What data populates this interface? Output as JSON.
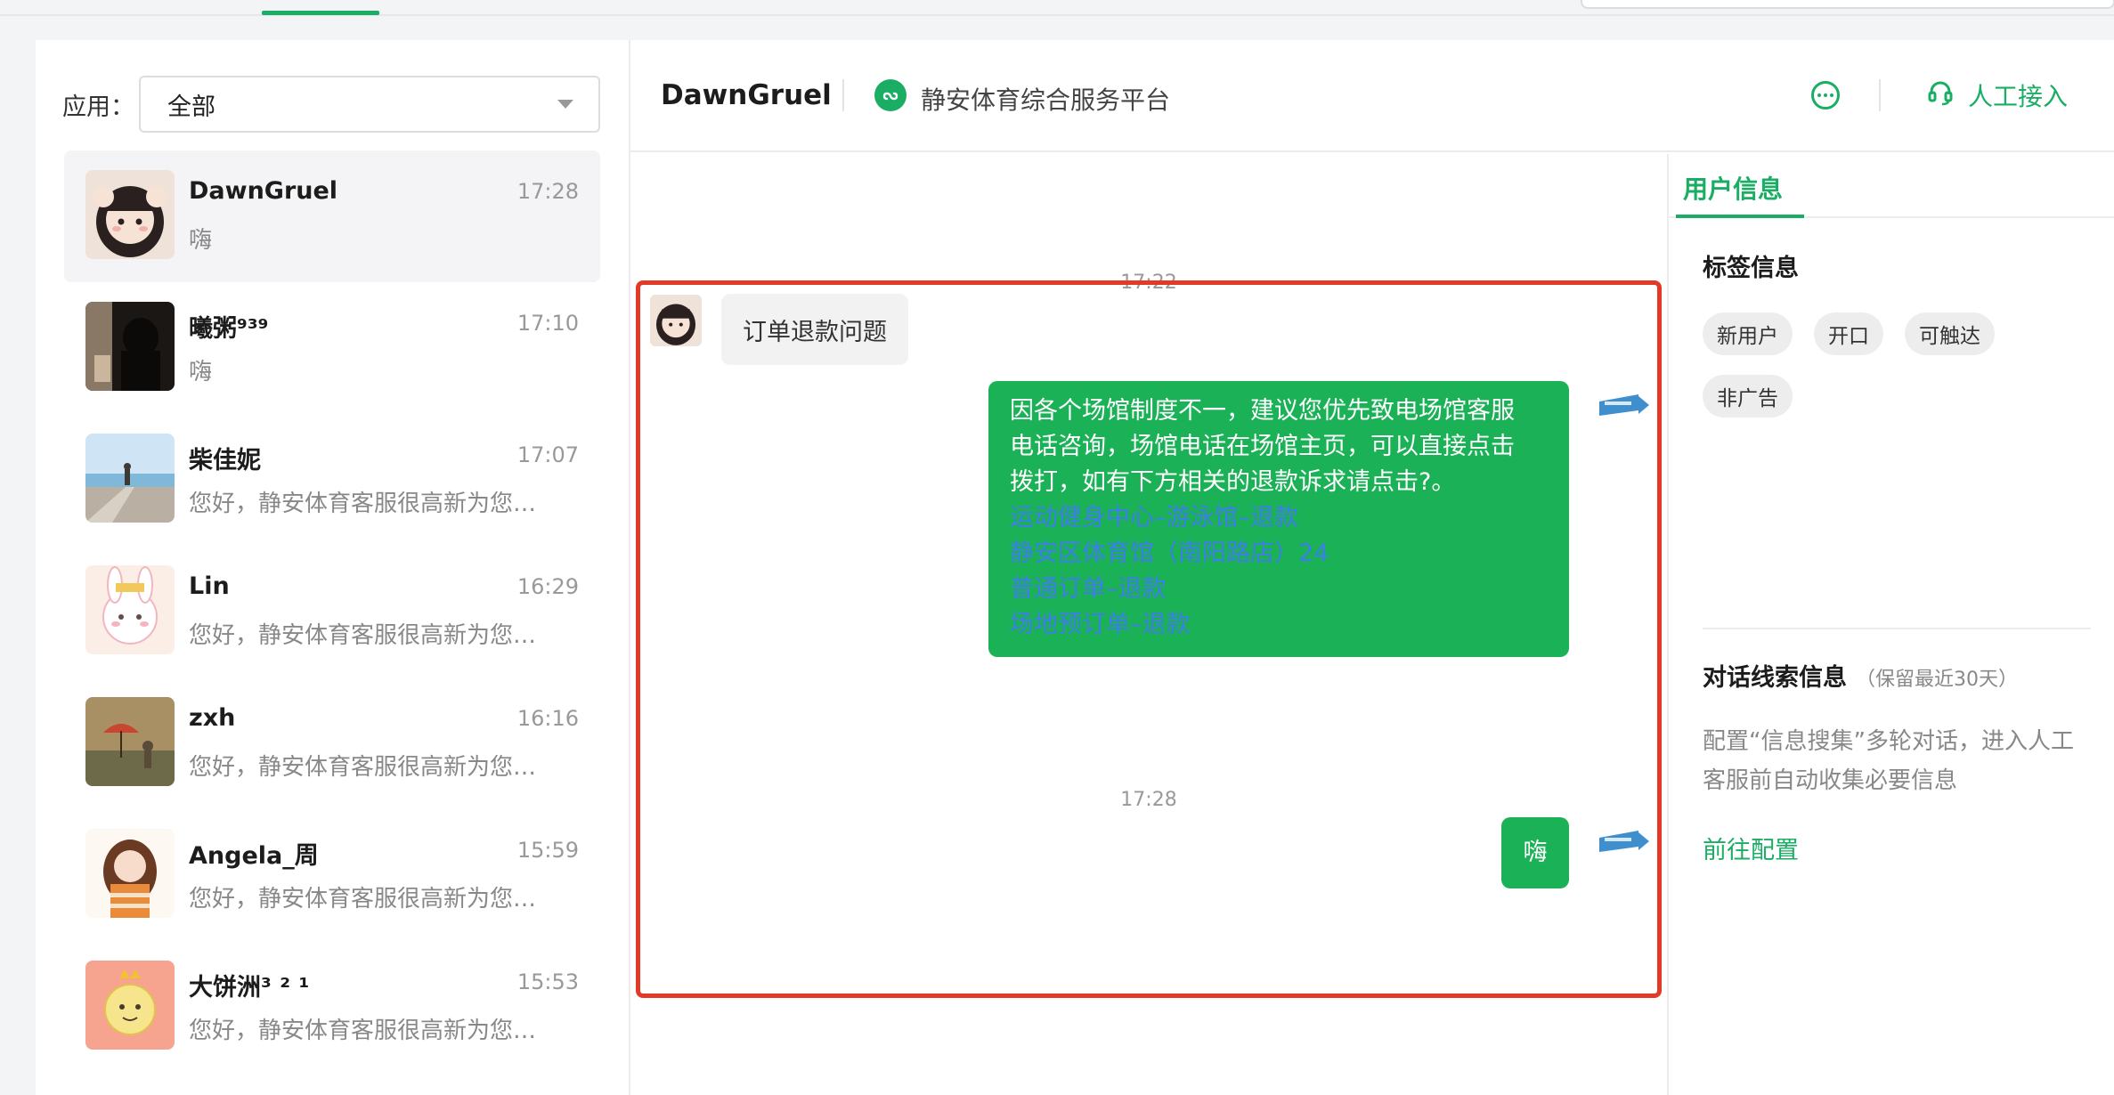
{
  "app_filter": {
    "label": "应用：",
    "value": "全部"
  },
  "conversations": [
    {
      "name": "DawnGruel",
      "time": "17:28",
      "snippet": "嗨",
      "avatar": "girl-cartoon-avatar"
    },
    {
      "name": "曦粥⁹³⁹",
      "time": "17:10",
      "snippet": "嗨",
      "avatar": "dark-photo-avatar"
    },
    {
      "name": "柴佳妮",
      "time": "17:07",
      "snippet": "您好，静安体育客服很高新为您…",
      "avatar": "seaside-photo-avatar"
    },
    {
      "name": "Lin",
      "time": "16:29",
      "snippet": "您好，静安体育客服很高新为您…",
      "avatar": "pink-bunny-avatar"
    },
    {
      "name": "zxh",
      "time": "16:16",
      "snippet": "您好，静安体育客服很高新为您…",
      "avatar": "painting-avatar"
    },
    {
      "name": "Angela_周",
      "time": "15:59",
      "snippet": "您好，静安体育客服很高新为您…",
      "avatar": "illustrated-girl-avatar"
    },
    {
      "name": "大饼洲³ ² ¹",
      "time": "15:53",
      "snippet": "您好，静安体育客服很高新为您…",
      "avatar": "pink-cartoon-avatar"
    }
  ],
  "chat": {
    "title": "DawnGruel",
    "mini_program_name": "静安体育综合服务平台",
    "human_agent_label": "人工接入",
    "timestamps": [
      "17:22",
      "17:28"
    ],
    "incoming_message": "订单退款问题",
    "outgoing_long": {
      "text_lines": [
        "因各个场馆制度不一，建议您优先致电场馆客服",
        "电话咨询，场馆电话在场馆主页，可以直接点击",
        "拨打，如有下方相关的退款诉求请点击?。"
      ],
      "links": [
        "运动健身中心–游泳馆–退款",
        "静安区体育馆（南阳路店）24",
        "普通订单–退款",
        "场地预订单–退款"
      ]
    },
    "outgoing_short": "嗨"
  },
  "user_info": {
    "tab_label": "用户信息",
    "tags_title": "标签信息",
    "tags": [
      "新用户",
      "开口",
      "可触达",
      "非广告"
    ],
    "leads_title": "对话线索信息",
    "leads_sub": "（保留最近30天）",
    "leads_desc": "配置“信息搜集”多轮对话，进入人工客服前自动收集必要信息",
    "leads_link": "前往配置"
  },
  "colors": {
    "accent": "#1aad64",
    "bubble_out": "#1bb157",
    "link": "#3d7ee8",
    "highlight": "#e23a26"
  }
}
